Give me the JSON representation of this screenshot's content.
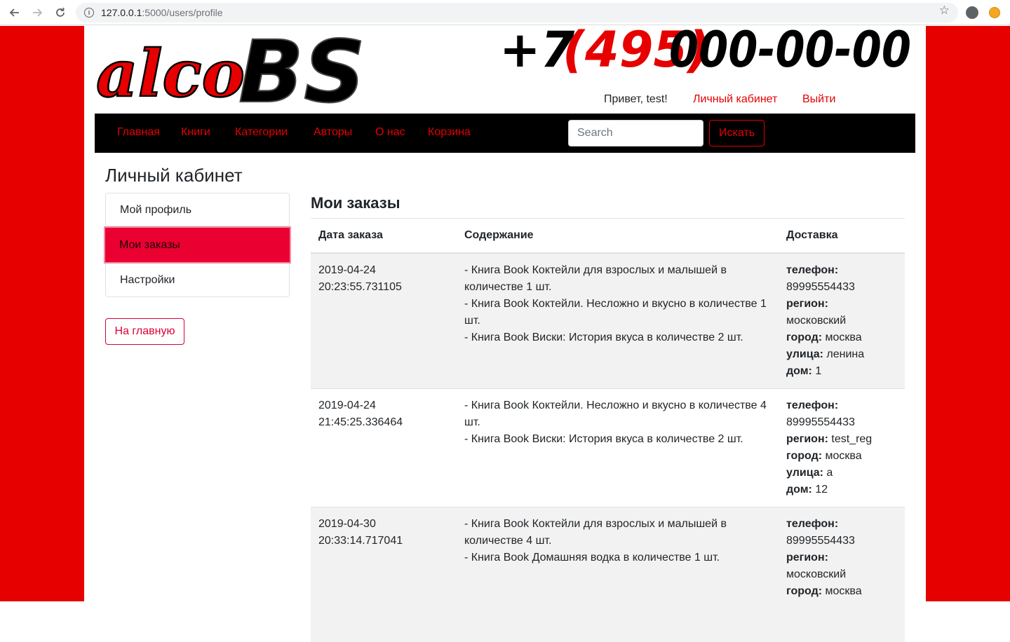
{
  "browser": {
    "url_host": "127.0.0.1",
    "url_rest": ":5000/users/profile"
  },
  "header": {
    "logo_text": "alcoBS",
    "phone_prefix": "+7",
    "phone_code": "(495)",
    "phone_number": "000-00-00",
    "greeting": "Привет, test!",
    "cabinet_link": "Личный кабинет",
    "logout_link": "Выйти"
  },
  "navbar": {
    "items": [
      "Главная",
      "Книги",
      "Категории",
      "Авторы",
      "О нас",
      "Корзина"
    ],
    "search_placeholder": "Search",
    "search_button": "Искать"
  },
  "sidebar": {
    "title": "Личный кабинет",
    "items": [
      "Мой профиль",
      "Мои заказы",
      "Настройки"
    ],
    "active": "Мои заказы",
    "home_button": "На главную"
  },
  "orders": {
    "title": "Мои заказы",
    "headers": [
      "Дата заказа",
      "Содержание",
      "Доставка"
    ],
    "labels": {
      "phone": "телефон:",
      "region": "регион:",
      "city": "город:",
      "street": "улица:",
      "house": "дом:"
    },
    "rows": [
      {
        "date": "2019-04-24",
        "time": "20:23:55.731105",
        "content": [
          "- Книга Book Коктейли для взрослых и малышей в количестве 1 шт.",
          "- Книга Book Коктейли. Несложно и вкусно в количестве 1 шт.",
          "- Книга Book Виски: История вкуса в количестве 2 шт."
        ],
        "phone": "89995554433",
        "region": "московский",
        "city": "москва",
        "street": "ленина",
        "house": "1"
      },
      {
        "date": "2019-04-24",
        "time": "21:45:25.336464",
        "content": [
          "- Книга Book Коктейли. Несложно и вкусно в количестве 4 шт.",
          "- Книга Book Виски: История вкуса в количестве 2 шт."
        ],
        "phone": "89995554433",
        "region": "test_reg",
        "city": "москва",
        "street": "а",
        "house": "12"
      },
      {
        "date": "2019-04-30",
        "time": "20:33:14.717041",
        "content": [
          "- Книга Book Коктейли для взрослых и малышей в количестве 4 шт.",
          "- Книга Book Домашняя водка в количестве 1 шт."
        ],
        "phone": "89995554433",
        "region": "московский",
        "city": "москва",
        "street": "",
        "house": ""
      }
    ]
  },
  "colors": {
    "brand_red": "#e60000",
    "active_item": "#eb0032",
    "navbar_bg": "#000000"
  }
}
